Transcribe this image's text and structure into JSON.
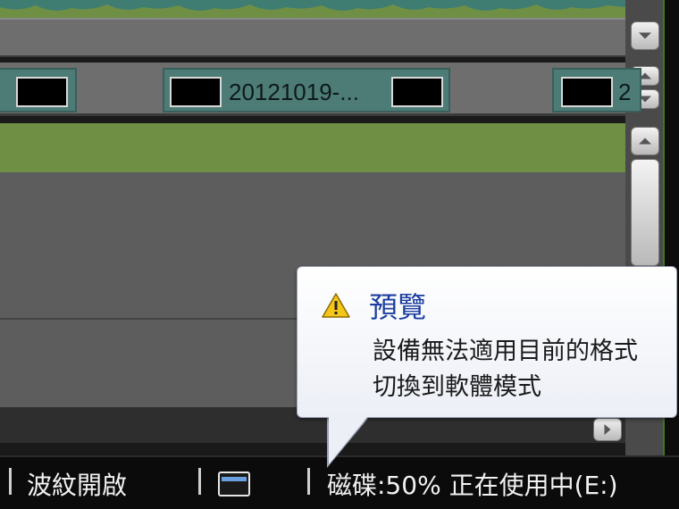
{
  "timeline": {
    "clips": [
      {
        "label": ""
      },
      {
        "label": "20121019-..."
      },
      {
        "label": "2"
      }
    ]
  },
  "tooltip": {
    "title": "預覽",
    "line1": "設備無法適用目前的格式",
    "line2": "切換到軟體模式",
    "icon": "warning-icon"
  },
  "status_bar": {
    "ripple": "波紋開啟",
    "disk": "磁碟:50% 正在使用中(E:)"
  },
  "colors": {
    "track_green": "#6f8f45",
    "clip_teal": "#4d7c76",
    "tooltip_title": "#1c3ea0"
  }
}
